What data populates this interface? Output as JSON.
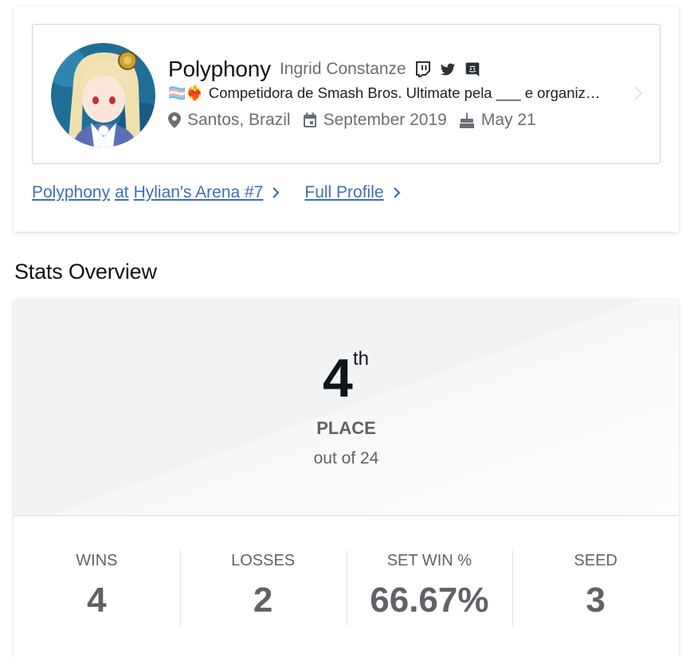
{
  "profile": {
    "gamertag": "Polyphony",
    "real_name": "Ingrid Constanze",
    "social_icons": [
      "twitch-icon",
      "twitter-icon",
      "discord-icon"
    ],
    "bio_flags": "🏳️‍⚧️❤️‍🔥",
    "bio": "Competidora de Smash Bros. Ultimate pela ___ e organiz…",
    "location": "Santos, Brazil",
    "joined": "September 2019",
    "birthday": "May 21"
  },
  "links": {
    "player_name": "Polyphony",
    "at_text": "at",
    "tournament": "Hylian's Arena #7",
    "full_profile": "Full Profile"
  },
  "stats": {
    "section_title": "Stats Overview",
    "placement": "4",
    "placement_suffix": "th",
    "place_label": "PLACE",
    "out_of": "out of 24",
    "cells": [
      {
        "label": "WINS",
        "value": "4"
      },
      {
        "label": "LOSSES",
        "value": "2"
      },
      {
        "label": "SET WIN %",
        "value": "66.67%"
      },
      {
        "label": "SEED",
        "value": "3"
      }
    ]
  },
  "colors": {
    "link": "#3f6fb8",
    "muted_text": "#5f6368",
    "heading": "#111111"
  }
}
